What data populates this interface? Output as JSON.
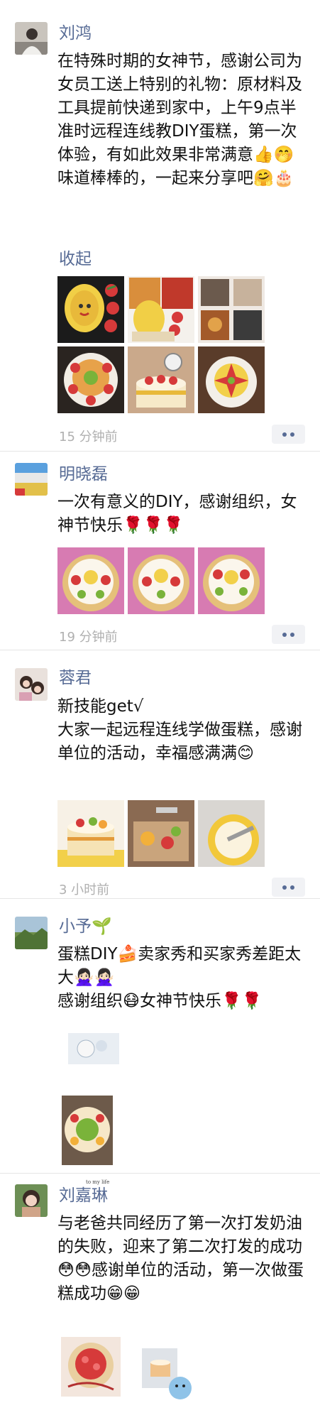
{
  "posts": [
    {
      "name": "刘鸿",
      "text": "在特殊时期的女神节，感谢公司为女员工送上特别的礼物：原材料及工具提前快递到家中，上午9点半准时远程连线教DIY蛋糕，第一次体验，有如此效果非常满意👍🤭味道棒棒的，一起来分享吧🤗🎂",
      "collapse_label": "收起",
      "time": "15 分钟前",
      "images": [
        "cake-diy-photo-1",
        "cake-diy-photo-2",
        "cake-diy-photo-3",
        "cake-diy-photo-4",
        "cake-diy-photo-5",
        "cake-diy-photo-6"
      ]
    },
    {
      "name": "明晓磊",
      "text": "一次有意义的DIY，感谢组织，女神节快乐🌹🌹🌹",
      "time": "19 分钟前",
      "images": [
        "fruit-cake-photo-1",
        "fruit-cake-photo-2",
        "fruit-cake-photo-3"
      ]
    },
    {
      "name": "蓉君",
      "text": "新技能get√\n大家一起远程连线学做蛋糕，感谢单位的活动，幸福感满满😊",
      "time": "3 小时前",
      "images": [
        "layer-cake-photo",
        "cutting-fruit-photo",
        "cream-cake-photo"
      ]
    },
    {
      "name": "小予🌱",
      "text": "蛋糕DIY🍰卖家秀和买家秀差距太大🙅🏻‍♀️🙅🏻‍♀️\n感谢组织😷女神节快乐🌹🌹",
      "images": [
        "seller-show-photo",
        "buyer-show-photo"
      ]
    },
    {
      "name": "刘嘉琳",
      "text": "与老爸共同经历了第一次打发奶油的失败，迎来了第二次打发的成功😳😳感谢单位的活动，第一次做蛋糕成功😁😁",
      "images": [
        "strawberry-cake-photo",
        "cartoon-cake-sticker"
      ]
    }
  ],
  "colors": {
    "name": "#576b95",
    "time": "#b0b0b0",
    "more_button_bg": "#f1f2f5",
    "divider": "#e5e5e5"
  }
}
